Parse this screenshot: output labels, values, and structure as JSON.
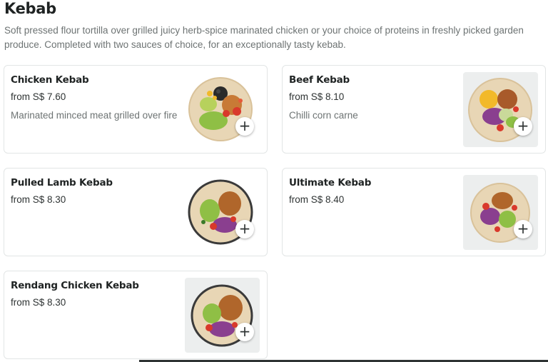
{
  "section": {
    "title": "Kebab",
    "description": "Soft pressed flour tortilla over grilled juicy herb-spice marinated chicken or your choice of proteins in freshly picked garden produce. Completed with two sauces of choice, for an exceptionally tasty kebab."
  },
  "items": [
    {
      "name": "Chicken Kebab",
      "price": "from S$ 7.60",
      "description": "Marinated minced meat grilled over fire",
      "image": "chicken-kebab-image",
      "add_icon": "+"
    },
    {
      "name": "Beef Kebab",
      "price": "from S$ 8.10",
      "description": "Chilli corn carne",
      "image": "beef-kebab-image",
      "add_icon": "+"
    },
    {
      "name": "Pulled Lamb Kebab",
      "price": "from S$ 8.30",
      "description": "",
      "image": "pulled-lamb-kebab-image",
      "add_icon": "+"
    },
    {
      "name": "Ultimate Kebab",
      "price": "from S$ 8.40",
      "description": "",
      "image": "ultimate-kebab-image",
      "add_icon": "+"
    },
    {
      "name": "Rendang Chicken Kebab",
      "price": "from S$ 8.30",
      "description": "",
      "image": "rendang-chicken-kebab-image",
      "add_icon": "+"
    }
  ],
  "colors": {
    "text_primary": "#1f2323",
    "text_secondary": "#6d7373",
    "card_border": "#e2e5e5",
    "thumb_bg": "#eceeee",
    "tortilla": "#e8d6b5",
    "meat": "#b0662b",
    "lettuce": "#8fbf45",
    "purple_cabbage": "#8a3f8f",
    "tomato": "#d9392b",
    "corn": "#f2b92a"
  }
}
